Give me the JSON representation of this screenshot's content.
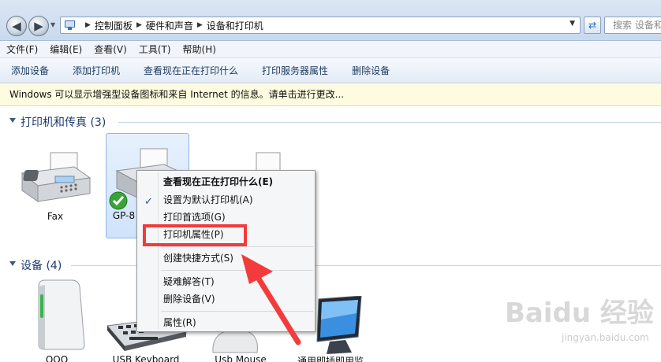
{
  "address_bar": {
    "breadcrumbs": [
      "控制面板",
      "硬件和声音",
      "设备和打印机"
    ],
    "search_placeholder": "搜索 设备和"
  },
  "menu": {
    "items": [
      "文件(F)",
      "编辑(E)",
      "查看(V)",
      "工具(T)",
      "帮助(H)"
    ]
  },
  "commands": {
    "items": [
      "添加设备",
      "添加打印机",
      "查看现在正在打印什么",
      "打印服务器属性",
      "删除设备"
    ]
  },
  "info_bar": {
    "text": "Windows 可以显示增强型设备图标和来自 Internet 的信息。请单击进行更改..."
  },
  "printers_group": {
    "title": "打印机和传真 (3)",
    "items": [
      {
        "label": "Fax",
        "icon": "fax-icon"
      },
      {
        "label": "GP-8",
        "icon": "printer-icon",
        "default": true,
        "selected": true
      },
      {
        "label": "",
        "icon": "printer-icon"
      }
    ]
  },
  "devices_group": {
    "title": "设备 (4)",
    "items": [
      {
        "label": "QQQ",
        "icon": "external-drive-icon"
      },
      {
        "label": "USB Keyboard",
        "icon": "keyboard-icon"
      },
      {
        "label": "Usb Mouse",
        "icon": "mouse-icon"
      },
      {
        "label": "通用即插即用监",
        "icon": "monitor-icon"
      }
    ]
  },
  "context_menu": {
    "items": [
      {
        "label": "查看现在正在打印什么(E)",
        "bold": true
      },
      {
        "label": "设置为默认打印机(A)",
        "checked": true
      },
      {
        "label": "打印首选项(G)"
      },
      {
        "label": "打印机属性(P)"
      },
      {
        "label": "创建快捷方式(S)"
      },
      {
        "label": "疑难解答(T)"
      },
      {
        "label": "删除设备(V)"
      },
      {
        "label": "属性(R)"
      }
    ]
  },
  "colors": {
    "highlight": "#f33b3b",
    "group_title": "#1e3a6e",
    "info_bar_bg": "#fffbe1"
  },
  "watermark": {
    "logo": "Baidu 经验",
    "url": "jingyan.baidu.com"
  }
}
